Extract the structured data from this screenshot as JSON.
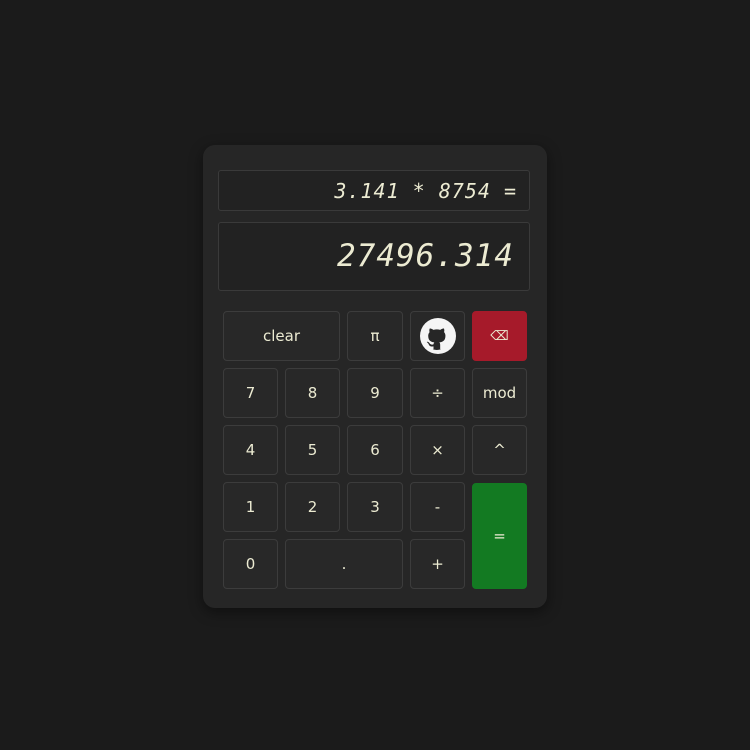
{
  "display": {
    "expression": "3.141 * 8754 =",
    "result": "27496.314"
  },
  "icons": {
    "github": "github-icon",
    "backspace": "backspace-icon"
  },
  "colors": {
    "background": "#1b1b1b",
    "body": "#262626",
    "button": "#282828",
    "text": "#ecebd2",
    "backspace": "#a61a2a",
    "equals": "#137a22"
  },
  "buttons": {
    "clear": "clear",
    "pi": "π",
    "backspace": "⌫",
    "seven": "7",
    "eight": "8",
    "nine": "9",
    "divide": "÷",
    "mod": "mod",
    "four": "4",
    "five": "5",
    "six": "6",
    "multiply": "×",
    "power": "^",
    "one": "1",
    "two": "2",
    "three": "3",
    "minus": "-",
    "equals": "=",
    "zero": "0",
    "decimal": ".",
    "plus": "+"
  }
}
